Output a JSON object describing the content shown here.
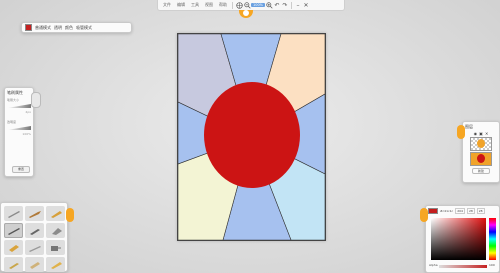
{
  "menu": {
    "items": [
      "文件",
      "编辑",
      "工具",
      "视图",
      "帮助"
    ]
  },
  "toolbar": {
    "zoom": "100%"
  },
  "brushbar": {
    "mode": "普通模式",
    "label_a": "透明",
    "label_b": "颜色",
    "label_c": "吸管模式"
  },
  "brush_props": {
    "title": "笔刷属性",
    "size_label": "笔刷大小",
    "opacity_label": "透明度",
    "size_value": "4px",
    "opacity_value": "100%",
    "reset_label": "重置"
  },
  "layers": {
    "title": "图层",
    "add_label": "新建"
  },
  "color_picker": {
    "hex": "#c41c1c",
    "r": "204",
    "g": "28",
    "b": "28",
    "alpha_label": "Alpha",
    "alpha_value": "100"
  },
  "colors": {
    "accent": "#f6a623",
    "canvas_red": "#cc1414",
    "seg_lavender": "#c7c9df",
    "seg_blue": "#a6c1ef",
    "seg_peach": "#fce0c2",
    "seg_cream": "#f3f4d4",
    "seg_sky": "#c2e4f5"
  },
  "tools": [
    "pencil-icon",
    "brush-icon",
    "marker-icon",
    "pen-icon",
    "dropper-icon",
    "eraser-icon",
    "bucket-icon",
    "knife-icon",
    "spray-icon",
    "stamp-icon",
    "smudge-icon",
    "palette-icon"
  ]
}
